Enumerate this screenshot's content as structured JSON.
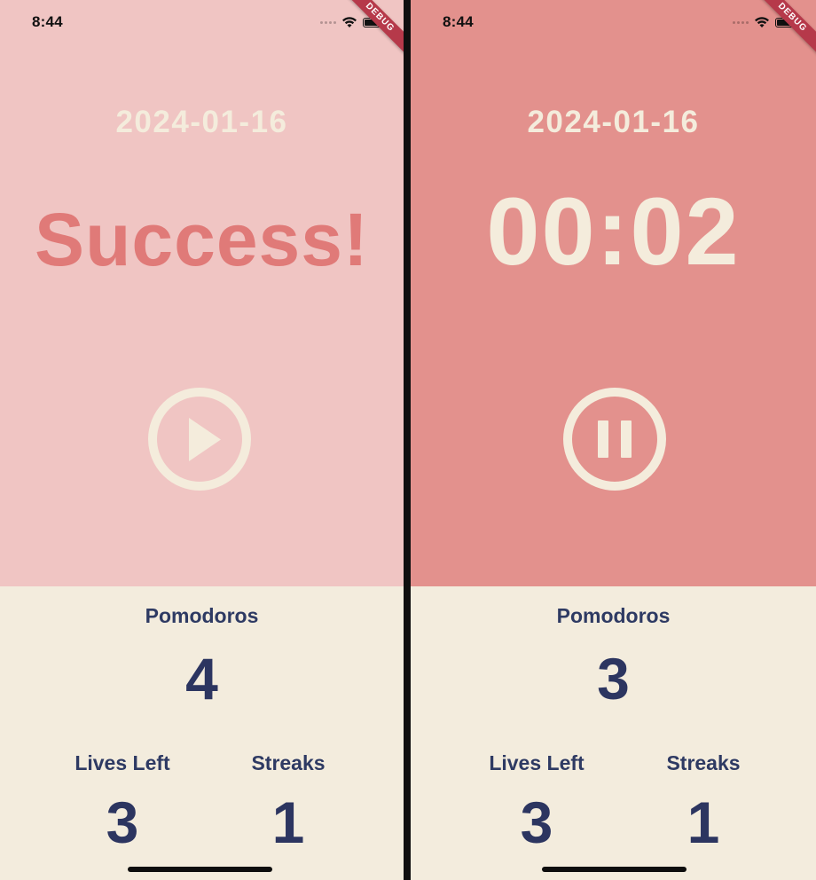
{
  "screens": [
    {
      "status_time": "8:44",
      "debug_label": "DEBUG",
      "date": "2024-01-16",
      "headline": "Success!",
      "control_icon": "play-icon",
      "pomodoros_label": "Pomodoros",
      "pomodoros_value": "4",
      "lives_label": "Lives Left",
      "lives_value": "3",
      "streaks_label": "Streaks",
      "streaks_value": "1"
    },
    {
      "status_time": "8:44",
      "debug_label": "DEBUG",
      "date": "2024-01-16",
      "headline": "00:02",
      "control_icon": "pause-icon",
      "pomodoros_label": "Pomodoros",
      "pomodoros_value": "3",
      "lives_label": "Lives Left",
      "lives_value": "3",
      "streaks_label": "Streaks",
      "streaks_value": "1"
    }
  ],
  "colors": {
    "success_top_bg": "#f0c5c3",
    "running_top_bg": "#e3918d",
    "bottom_bg": "#f3ecdd",
    "cream": "#f4ecdc",
    "success_text": "#e07a78",
    "navy": "#2c3560"
  }
}
